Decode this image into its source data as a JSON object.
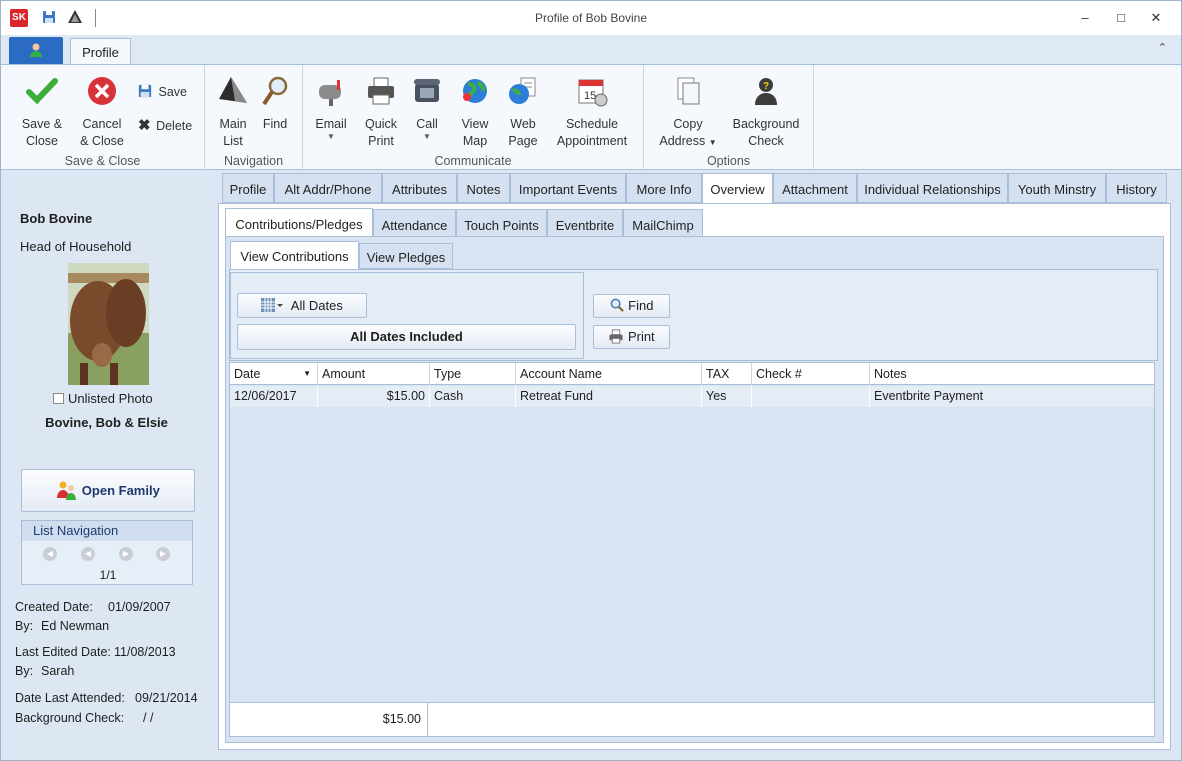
{
  "window": {
    "title": "Profile of Bob Bovine",
    "logo_text": "SK"
  },
  "ribbon": {
    "tab": "Profile",
    "groups": {
      "save_close": "Save & Close",
      "navigation": "Navigation",
      "communicate": "Communicate",
      "options": "Options"
    },
    "buttons": {
      "save_close": [
        "Save &",
        "Close"
      ],
      "cancel_close": [
        "Cancel",
        "& Close"
      ],
      "save": "Save",
      "delete": "Delete",
      "main_list": [
        "Main",
        "List"
      ],
      "find": "Find",
      "email": "Email",
      "quick_print": [
        "Quick",
        "Print"
      ],
      "call": "Call",
      "view_map": [
        "View",
        "Map"
      ],
      "web_page": [
        "Web",
        "Page"
      ],
      "schedule_appointment": [
        "Schedule",
        "Appointment"
      ],
      "copy_address": [
        "Copy",
        "Address"
      ],
      "background_check": [
        "Background",
        "Check"
      ]
    }
  },
  "person": {
    "name": "Bob Bovine",
    "role": "Head of Household",
    "unlisted_photo": "Unlisted Photo",
    "family": "Bovine, Bob & Elsie",
    "open_family": "Open Family",
    "list_navigation": "List Navigation",
    "position": "1/1",
    "created_date_label": "Created Date:",
    "created_date": "01/09/2007",
    "created_by_label": "By:",
    "created_by": "Ed Newman",
    "last_edited_label": "Last Edited Date:",
    "last_edited": "11/08/2013",
    "edited_by_label": "By:",
    "edited_by": "Sarah",
    "last_attended_label": "Date Last Attended:",
    "last_attended": "09/21/2014",
    "background_check_label": "Background Check:",
    "background_check": "/  /"
  },
  "tabs": [
    "Profile",
    "Alt Addr/Phone",
    "Attributes",
    "Notes",
    "Important Events",
    "More Info",
    "Overview",
    "Attachment",
    "Individual Relationships",
    "Youth Minstry",
    "History"
  ],
  "subtabs": [
    "Contributions/Pledges",
    "Attendance",
    "Touch Points",
    "Eventbrite",
    "MailChimp"
  ],
  "viewtabs": [
    "View Contributions",
    "View Pledges"
  ],
  "filter": {
    "date_button": "All Dates",
    "summary": "All Dates Included",
    "find": "Find",
    "print": "Print"
  },
  "grid": {
    "columns": [
      "Date",
      "Amount",
      "Type",
      "Account Name",
      "TAX",
      "Check #",
      "Notes"
    ],
    "rows": [
      [
        "12/06/2017",
        "$15.00",
        "Cash",
        "Retreat Fund",
        "Yes",
        "",
        "Eventbrite Payment"
      ]
    ],
    "total": "$15.00"
  },
  "colors": {
    "accent": "#2b6cc2",
    "brand": "#d9262b",
    "selected_row": "#e4ecf6"
  }
}
